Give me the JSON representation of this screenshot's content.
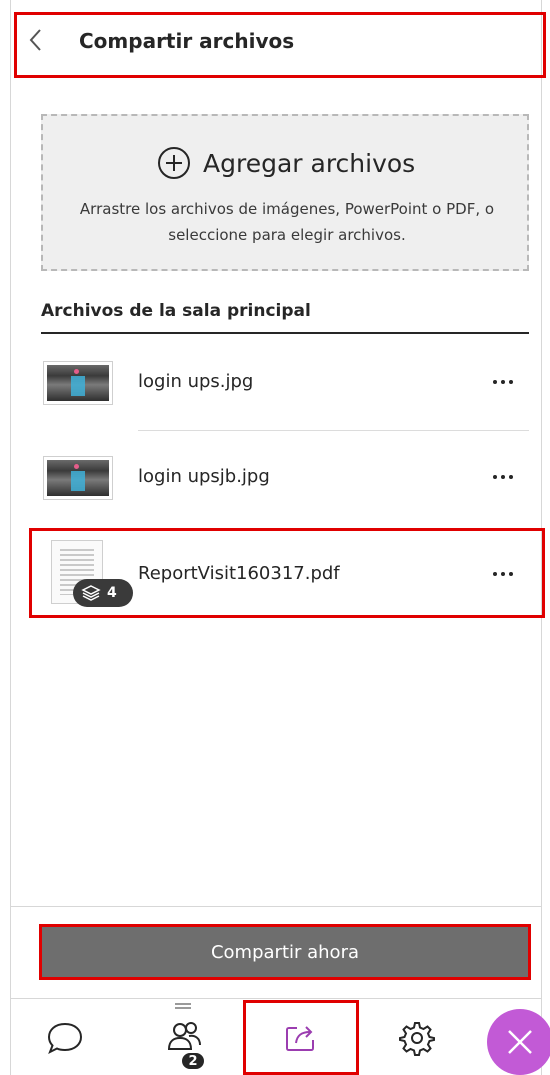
{
  "header": {
    "title": "Compartir archivos"
  },
  "dropzone": {
    "add_label": "Agregar archivos",
    "hint": "Arrastre los archivos de imágenes, PowerPoint o PDF, o seleccione para elegir archivos."
  },
  "section": {
    "title": "Archivos de la sala principal"
  },
  "files": [
    {
      "name": "login ups.jpg",
      "type": "image"
    },
    {
      "name": "login upsjb.jpg",
      "type": "image"
    },
    {
      "name": "ReportVisit160317.pdf",
      "type": "pdf",
      "page_count": "4"
    }
  ],
  "footer": {
    "share_label": "Compartir ahora"
  },
  "tabs": [
    {
      "name": "chat",
      "icon": "chat-bubble-icon"
    },
    {
      "name": "attendees",
      "icon": "people-icon",
      "badge": "2"
    },
    {
      "name": "share-content",
      "icon": "share-icon",
      "active": true
    },
    {
      "name": "settings",
      "icon": "gear-icon"
    },
    {
      "name": "close",
      "icon": "close-icon"
    }
  ],
  "colors": {
    "highlight": "#e00000",
    "accent": "#9b3db0",
    "close_button": "#c25ad6",
    "share_button": "#6e6e6e"
  }
}
